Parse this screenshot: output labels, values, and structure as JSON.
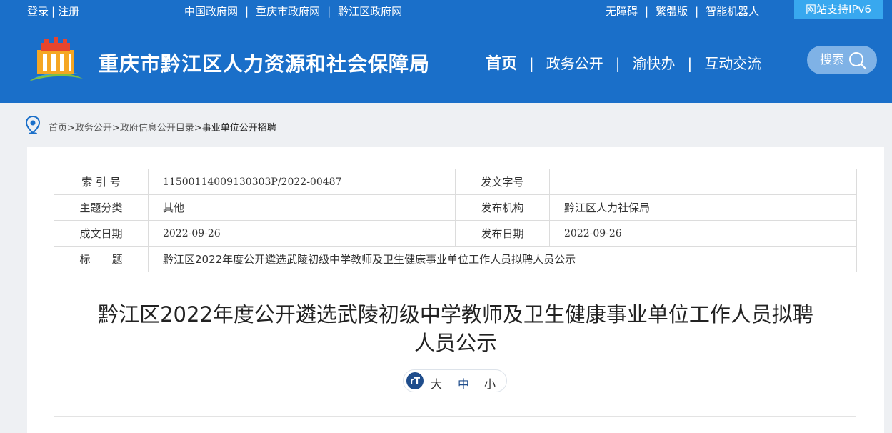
{
  "topbar": {
    "login": "登录",
    "register": "注册",
    "link_gov": "中国政府网",
    "link_cq": "重庆市政府网",
    "link_qj": "黔江区政府网",
    "accessible": "无障碍",
    "traditional": "繁體版",
    "robot": "智能机器人",
    "ipv6": "网站支持IPv6"
  },
  "header": {
    "site_title": "重庆市黔江区人力资源和社会保障局",
    "nav": [
      "首页",
      "政务公开",
      "渝快办",
      "互动交流"
    ],
    "search_label": "搜索"
  },
  "breadcrumb": [
    "首页",
    "政务公开",
    "政府信息公开目录",
    "事业单位公开招聘"
  ],
  "meta": {
    "index_label": "索 引 号",
    "index_value": "11500114009130303P/2022-00487",
    "doc_no_label": "发文字号",
    "doc_no_value": "",
    "topic_label": "主题分类",
    "topic_value": "其他",
    "issuer_label": "发布机构",
    "issuer_value": "黔江区人力社保局",
    "created_label": "成文日期",
    "created_value": "2022-09-26",
    "published_label": "发布日期",
    "published_value": "2022-09-26",
    "title_label": "标　　题",
    "title_value": "黔江区2022年度公开遴选武陵初级中学教师及卫生健康事业单位工作人员拟聘人员公示"
  },
  "article": {
    "title_line1": "黔江区2022年度公开遴选武陵初级中学教师及卫生健康事业单位工作人员拟聘",
    "title_line2": "人员公示"
  },
  "font_size": {
    "icon_text": "rT",
    "large": "大",
    "medium": "中",
    "small": "小"
  },
  "colors": {
    "header_bg": "#1a6fc9",
    "ipv6_bg": "#38a8ef",
    "accent_dark": "#1f4d8c"
  }
}
